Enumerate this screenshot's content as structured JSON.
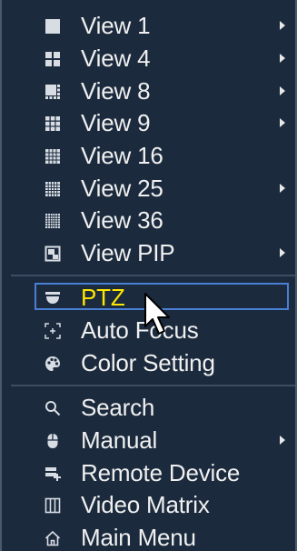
{
  "menu": {
    "view_items": [
      {
        "label": "View 1",
        "icon": "single-square-icon",
        "has_submenu": true
      },
      {
        "label": "View 4",
        "icon": "grid-4-icon",
        "has_submenu": true
      },
      {
        "label": "View 8",
        "icon": "grid-8-icon",
        "has_submenu": true
      },
      {
        "label": "View 9",
        "icon": "grid-9-icon",
        "has_submenu": true
      },
      {
        "label": "View 16",
        "icon": "grid-16-icon",
        "has_submenu": false
      },
      {
        "label": "View 25",
        "icon": "grid-25-icon",
        "has_submenu": true
      },
      {
        "label": "View 36",
        "icon": "grid-36-icon",
        "has_submenu": false
      },
      {
        "label": "View PIP",
        "icon": "picture-in-picture-icon",
        "has_submenu": true
      }
    ],
    "control_items": [
      {
        "label": "PTZ",
        "icon": "ptz-camera-icon",
        "selected": true
      },
      {
        "label": "Auto Focus",
        "icon": "focus-icon",
        "selected": false
      },
      {
        "label": "Color Setting",
        "icon": "palette-icon",
        "selected": false
      }
    ],
    "system_items": [
      {
        "label": "Search",
        "icon": "search-icon",
        "has_submenu": false
      },
      {
        "label": "Manual",
        "icon": "mouse-icon",
        "has_submenu": true
      },
      {
        "label": "Remote Device",
        "icon": "remote-device-icon",
        "has_submenu": false
      },
      {
        "label": "Video Matrix",
        "icon": "video-matrix-icon",
        "has_submenu": false
      },
      {
        "label": "Main Menu",
        "icon": "home-icon",
        "has_submenu": false
      }
    ]
  },
  "colors": {
    "background": "#1b2a3d",
    "text": "#f0f0f0",
    "selected_text": "#ffe600",
    "selection_border": "#4a7fd6"
  }
}
